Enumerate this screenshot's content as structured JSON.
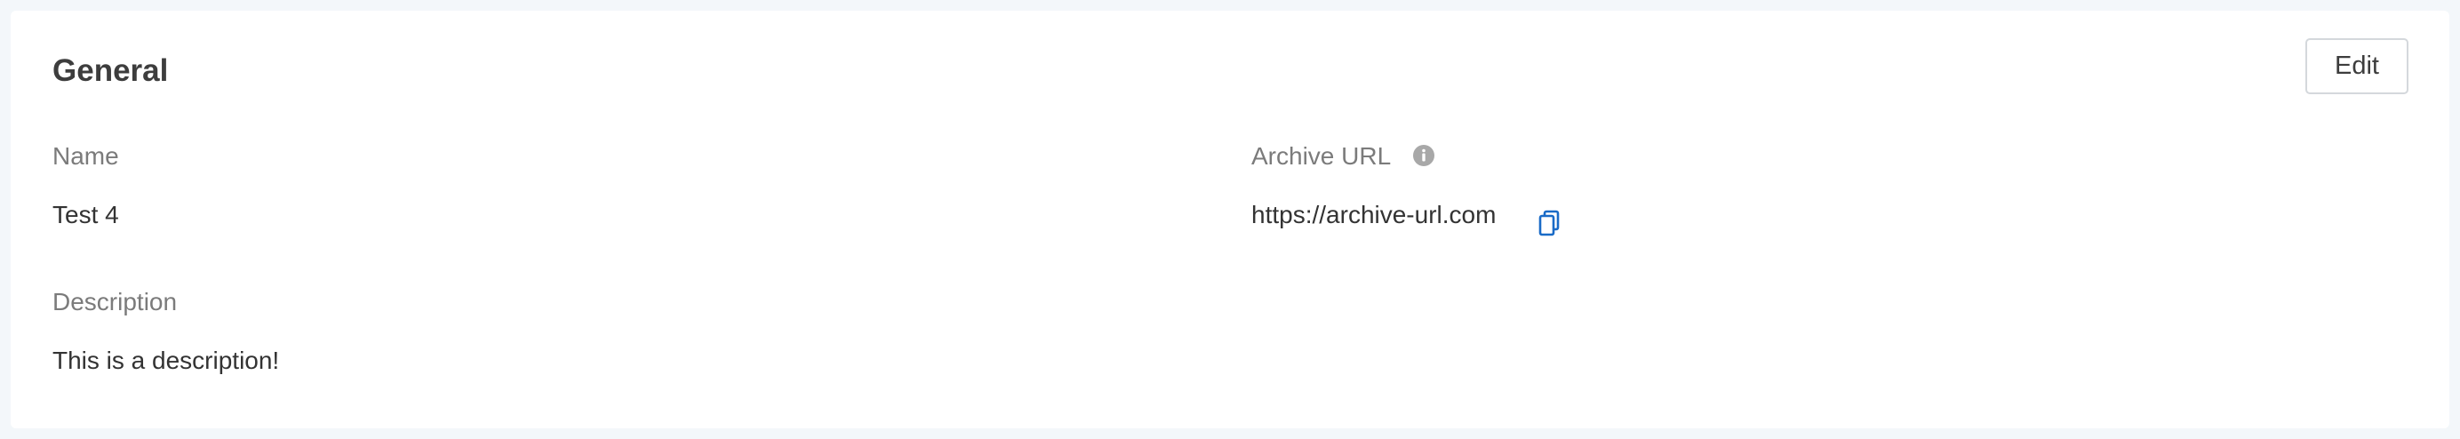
{
  "section": {
    "title": "General",
    "edit_label": "Edit"
  },
  "fields": {
    "name": {
      "label": "Name",
      "value": "Test 4"
    },
    "archive_url": {
      "label": "Archive URL",
      "value": "https://archive-url.com",
      "info_icon": "info-icon",
      "copy_icon": "copy-icon"
    },
    "description": {
      "label": "Description",
      "value": "This is a description!"
    }
  },
  "colors": {
    "background": "#f3f7fa",
    "card": "#ffffff",
    "label": "#7b7b7b",
    "value": "#333333",
    "copy_icon": "#1a6bc7",
    "info_icon": "#a8a8a8"
  }
}
